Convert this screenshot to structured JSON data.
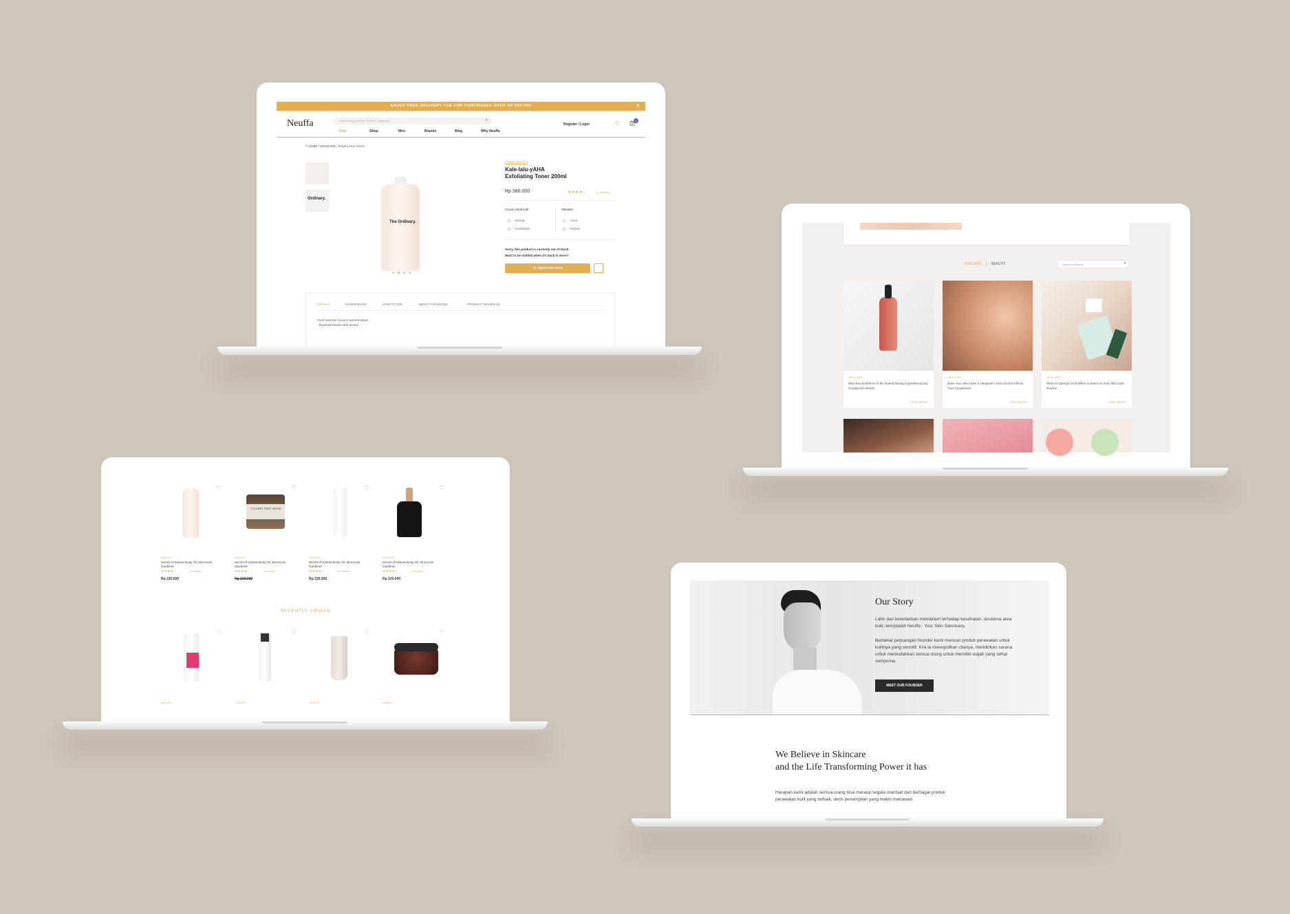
{
  "laptop1": {
    "banner": "ENJOY FREE DELIVERY FEE FOR PURCHASES OVER RP 500.000",
    "close": "✕",
    "logo": "Neuffa",
    "search_placeholder": "Search any products / brands / categories",
    "nav": [
      "New",
      "Shop",
      "Men",
      "Brands",
      "Blog",
      "Why Neuffa"
    ],
    "register": "Register / Login",
    "cart_count": "1",
    "breadcrumb": "< HOME / SKINCARE / KALE-LALU-YAHA",
    "brand_link": "ARNIE BEAUTY",
    "product_title_1": "Kale-lalu-yAHA",
    "product_title_2": "Exfoliating Toner 200ml",
    "price": "Rp 380.000",
    "rating_stars": 4,
    "reviews": "(4 reviews)",
    "skin_label": "Cocok untuk kulit",
    "skin_types": [
      "Kering",
      "Kombinasi"
    ],
    "problem_label": "Masalah",
    "problems": [
      "Acne",
      "Kerput"
    ],
    "stock_msg_1": "Sorry, this product is currently out of stock.",
    "stock_msg_2": "Want to be notified when it's back in store?",
    "notify_btn": "YA, BERITAHU SAYA",
    "tabs": [
      "DETAILS",
      "INGREDIENTS",
      "HOW TO USE",
      "ABOUT THE BRAND",
      "PRODUCT REVIEW (0)"
    ],
    "detail_1": "You'll love this if you're worried about...",
    "detail_2": "- Dryness/Uneven skin texture",
    "bottle_brand": "The Ordinary."
  },
  "laptop2": {
    "cat_active": "SKINCARE",
    "cat_sep": "|",
    "cat_other": "BEAUTY",
    "search_placeholder": "Search in Stories",
    "cards": [
      {
        "tag": "SKINCARE",
        "title": "Why Sea Buckthorn is the Overachieving Ingredient Every Complexion Needs",
        "more": "READ MORE>"
      },
      {
        "tag": "SKINCARE",
        "title": "Does Your Skin Have a Hangover? How Alcohol Affects Your Complexion",
        "more": "READ MORE>"
      },
      {
        "tag": "SKINCARE",
        "title": "When to Splurge (And When to Save) on Your Skin Care Routine",
        "more": "READ MORE>"
      }
    ]
  },
  "laptop3": {
    "products": [
      {
        "brand": "HUXLEY",
        "name": "Secret of Sahara Body Oil; Moroccan Gardener",
        "reviews": "(4 reviews)",
        "price": "Rp 220.000",
        "stars": 4
      },
      {
        "brand": "HUXLEY",
        "name": "Secret of Sahara Body Oil; Moroccan Gardener",
        "reviews": "(4 reviews)",
        "price": "Rp 220.000",
        "stars": 4
      },
      {
        "brand": "HUXLEY",
        "name": "Secret of Sahara Body Oil; Moroccan Gardener",
        "reviews": "(4 reviews)",
        "price": "Rp 220.000",
        "stars": 4
      },
      {
        "brand": "HUXLEY",
        "name": "Secret of Sahara Body Oil; Moroccan Gardener",
        "reviews": "(4 reviews)",
        "price": "Rp 220.000",
        "stars": 4
      }
    ],
    "recent_heading": "RECENTLY VIEWED",
    "recent_brands": [
      "HUXLEY",
      "HUXLEY",
      "HUXLEY",
      "HUXLEY"
    ],
    "mask_label": "VITAMIN TREE MASK"
  },
  "laptop4": {
    "story_title": "Our Story",
    "story_p1": "Lahir dari ketertarikan mendalam terhadap kesehatan, terutama area kulit, terciptalah Neuffa : Your Skin Sanctuary.",
    "story_p2": "Berbekal perjuangan founder kami mencari produk perawatan untuk kulitnya yang sensitif. Kini ia mewujudkan citanya, mendirikan sarana untuk memudahkan semua orang untuk memiliki wajah yang sehat sempurna.",
    "founder_btn": "MEET OUR FOUNDER",
    "believe_1": "We Believe in Skincare",
    "believe_2": "and the Life Transforming Power it has",
    "hope": "Harapan kami adalah semua orang bisa meraup segala manfaat dari berbagai produk perawatan kulit yang terbaik, demi penampilan yang makin menawan"
  },
  "colors": {
    "background": "#cfc6bb",
    "accent": "#e3ad52",
    "dark_button": "#2a2a2a",
    "cart_badge": "#5b5bd6"
  }
}
